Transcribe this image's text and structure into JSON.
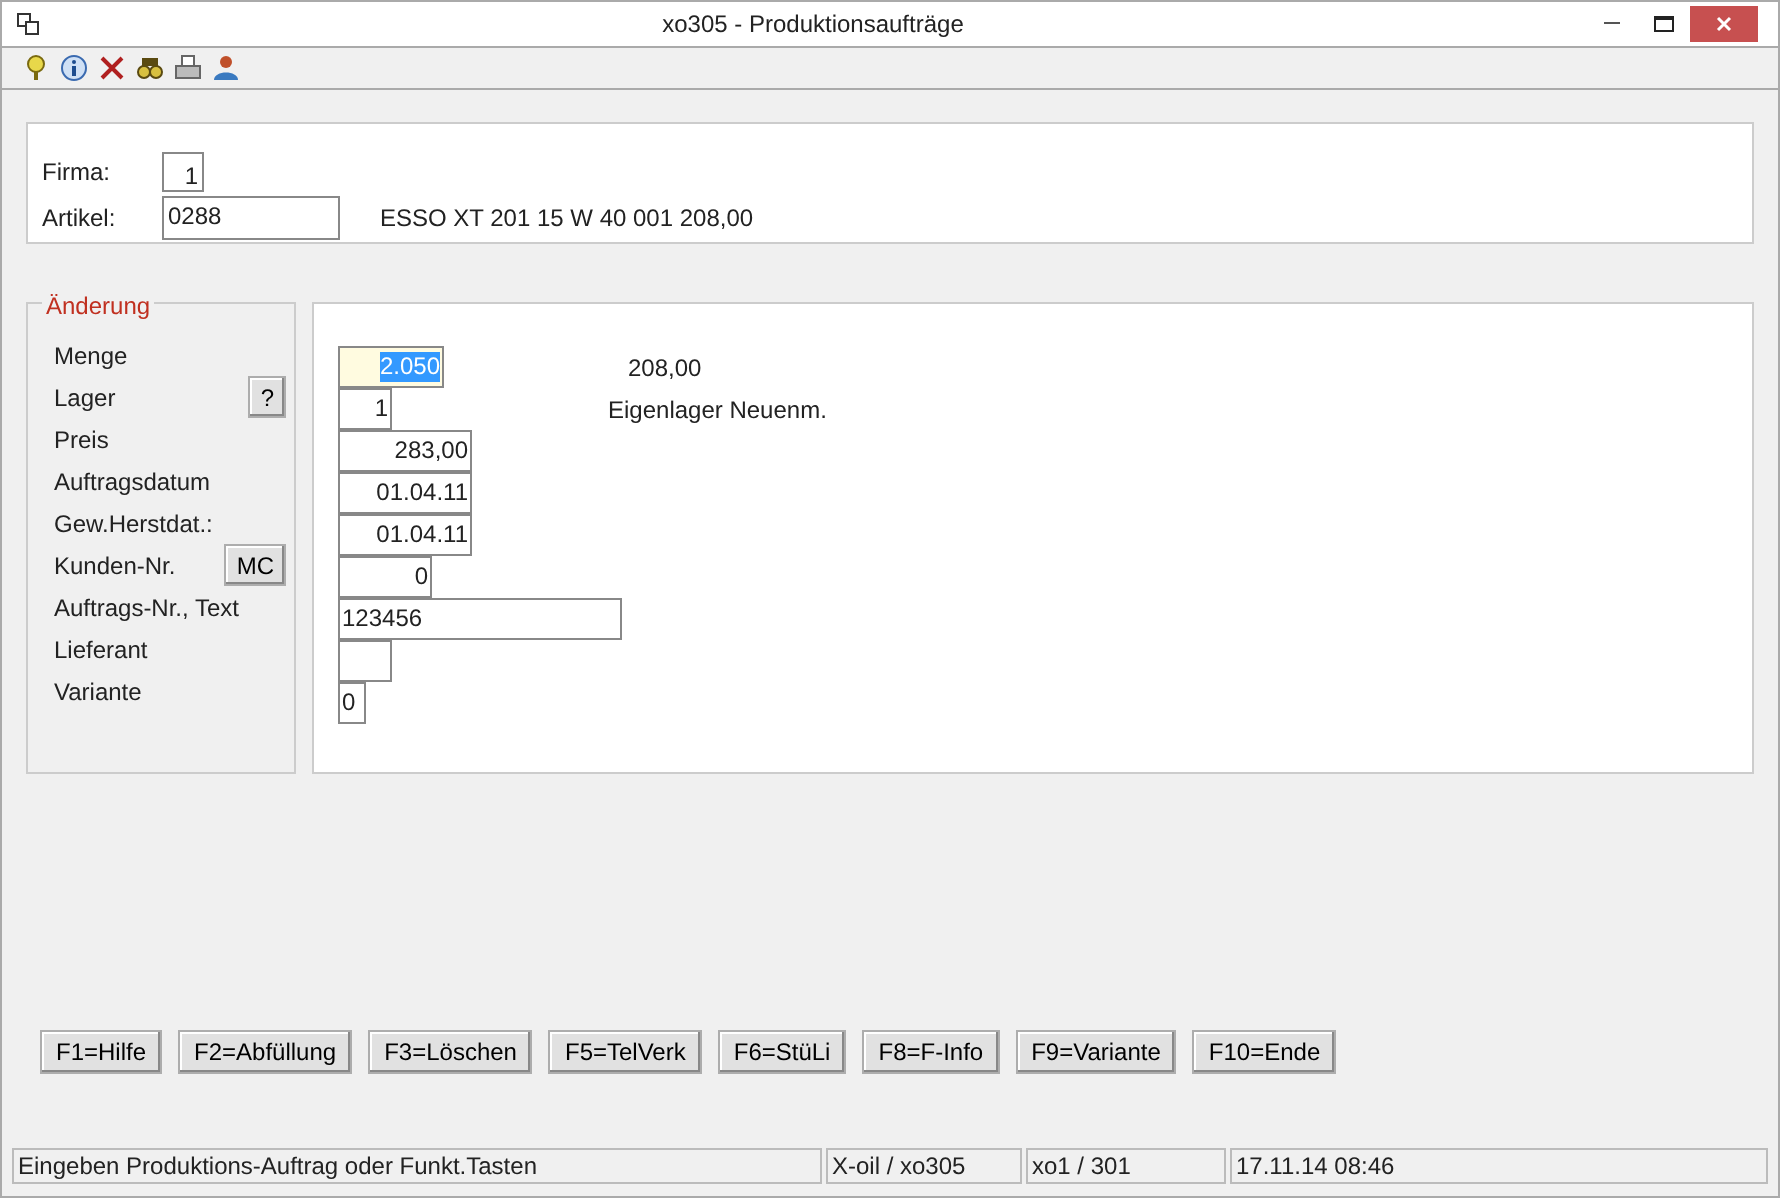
{
  "window": {
    "title": "xo305 - Produktionsaufträge"
  },
  "toolbar": {
    "icons": [
      {
        "kind": "help"
      },
      {
        "kind": "info"
      },
      {
        "kind": "delete"
      },
      {
        "kind": "search"
      },
      {
        "kind": "print"
      },
      {
        "kind": "user"
      }
    ]
  },
  "header": {
    "firma": {
      "label": "Firma:",
      "value": "1"
    },
    "artikel": {
      "label": "Artikel:",
      "value": "0288",
      "description": "ESSO XT 201 15 W 40 001 208,00"
    }
  },
  "group": {
    "title": "Änderung"
  },
  "fields": [
    {
      "label": "Menge",
      "value": "2.050",
      "selected": true,
      "aside": "208,00"
    },
    {
      "label": "Lager",
      "button": "?",
      "value": "1",
      "selected": false,
      "aside": "Eigenlager Neuenm."
    },
    {
      "label": "Preis",
      "value": "283,00",
      "selected": false
    },
    {
      "label": "Auftragsdatum",
      "value": "01.04.11",
      "selected": false
    },
    {
      "label": "Gew.Herstdat.:",
      "value": "01.04.11",
      "selected": false
    },
    {
      "label": "Kunden-Nr.",
      "button": "MC",
      "value": "0",
      "selected": false
    },
    {
      "label": "Auftrags-Nr., Text",
      "value": "123456",
      "selected": false
    },
    {
      "label": "Lieferant",
      "selected": false
    },
    {
      "label": "Variante",
      "value": "0",
      "selected": false
    }
  ],
  "function_keys": [
    "F1=Hilfe",
    "F2=Abfüllung",
    "F3=Löschen",
    "F5=TelVerk",
    "F6=StüLi",
    "F8=F-Info",
    "F9=Variante",
    "F10=Ende"
  ],
  "status_bar": [
    "Eingeben Produktions-Auftrag oder Funkt.Tasten",
    "X-oil / xo305",
    "xo1 / 301",
    "17.11.14 08:46"
  ]
}
